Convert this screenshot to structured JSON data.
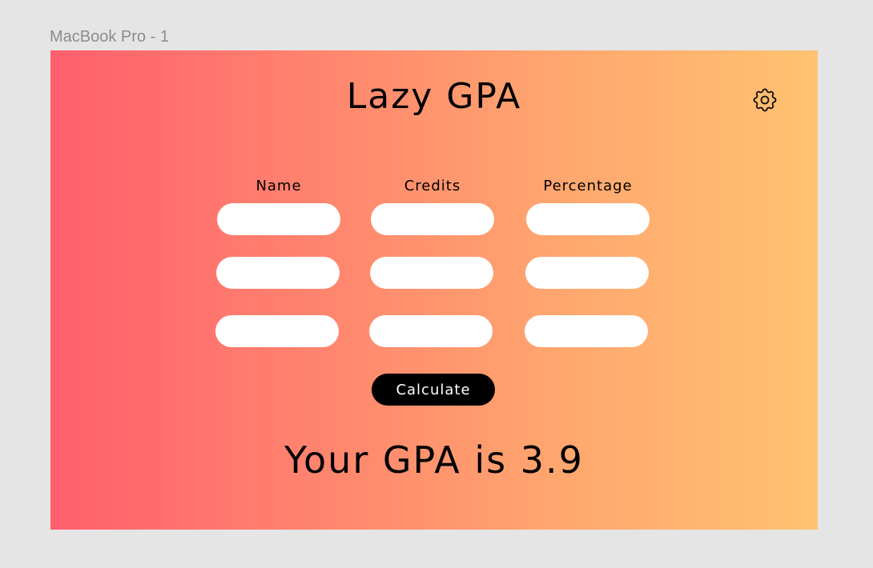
{
  "frame": {
    "label": "MacBook Pro - 1",
    "gradient_start": "#ff5f6d",
    "gradient_end": "#ffc371"
  },
  "header": {
    "title": "Lazy GPA",
    "settings_icon": "gear-icon"
  },
  "form": {
    "columns": [
      "Name",
      "Credits",
      "Percentage"
    ],
    "rows": [
      {
        "name": "",
        "credits": "",
        "percentage": ""
      },
      {
        "name": "",
        "credits": "",
        "percentage": ""
      },
      {
        "name": "",
        "credits": "",
        "percentage": ""
      }
    ]
  },
  "actions": {
    "calculate_label": "Calculate"
  },
  "result": {
    "text": "Your GPA is 3.9"
  }
}
